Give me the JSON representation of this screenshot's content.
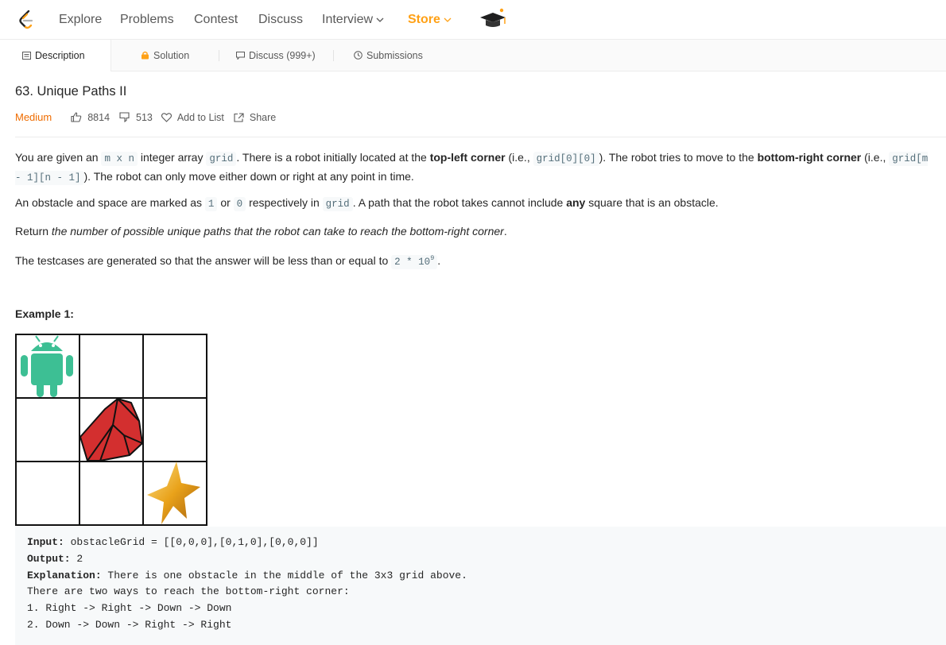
{
  "nav": {
    "items": [
      "Explore",
      "Problems",
      "Contest",
      "Discuss",
      "Interview",
      "Store"
    ]
  },
  "tabs": {
    "description": "Description",
    "solution": "Solution",
    "discuss": "Discuss (999+)",
    "submissions": "Submissions"
  },
  "problem": {
    "title": "63. Unique Paths II",
    "difficulty": "Medium",
    "likes": "8814",
    "dislikes": "513",
    "add_to_list": "Add to List",
    "share": "Share"
  },
  "description": {
    "p1": {
      "t1": "You are given an ",
      "c1": "m x n",
      "t2": " integer array ",
      "c2": "grid",
      "t3": ". There is a robot initially located at the ",
      "b1": "top-left corner",
      "t4": " (i.e., ",
      "c3": "grid[0][0]",
      "t5": "). The robot tries to move to the ",
      "b2": "bottom-right corner",
      "t6": " (i.e., ",
      "c4": "grid[m - 1][n - 1]",
      "t7": "). The robot can only move either down or right at any point in time."
    },
    "p2": {
      "t1": "An obstacle and space are marked as ",
      "c1": "1",
      "t2": " or ",
      "c2": "0",
      "t3": " respectively in ",
      "c3": "grid",
      "t4": ". A path that the robot takes cannot include ",
      "b1": "any",
      "t5": " square that is an obstacle."
    },
    "p3": {
      "t1": "Return ",
      "i1": "the number of possible unique paths that the robot can take to reach the bottom-right corner",
      "t2": "."
    },
    "p4": {
      "t1": "The testcases are generated so that the answer will be less than or equal to ",
      "c1": "2 * 10",
      "sup": "9",
      "t2": "."
    }
  },
  "example": {
    "title": "Example 1:",
    "input_label": "Input:",
    "input_value": " obstacleGrid = [[0,0,0],[0,1,0],[0,0,0]]",
    "output_label": "Output:",
    "output_value": " 2",
    "explanation_label": "Explanation:",
    "explanation_value": " There is one obstacle in the middle of the 3x3 grid above.",
    "line4": "There are two ways to reach the bottom-right corner:",
    "line5": "1. Right -> Right -> Down -> Down",
    "line6": "2. Down -> Down -> Right -> Right"
  },
  "colors": {
    "brand_orange": "#ffa116",
    "medium": "#ef6c00",
    "robot": "#3dbf94",
    "obstacle": "#d32f2f",
    "goal": "#e9a21a"
  },
  "icons": [
    "leetcode-logo-icon",
    "chevron-down-icon",
    "graduation-cap-icon",
    "description-icon",
    "lock-icon",
    "comment-icon",
    "clock-icon",
    "thumbs-up-icon",
    "thumbs-down-icon",
    "heart-icon",
    "share-icon",
    "android-robot-icon",
    "obstacle-rock-icon",
    "star-goal-icon"
  ]
}
